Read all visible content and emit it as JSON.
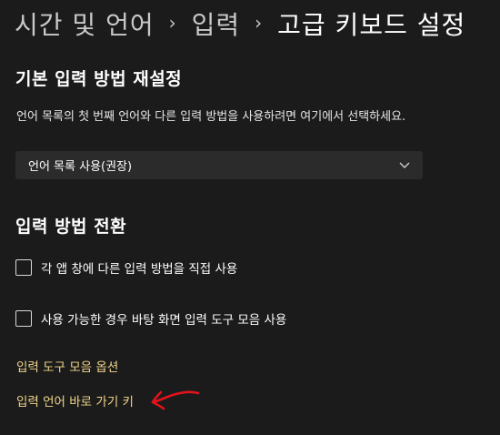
{
  "breadcrumb": {
    "parent1": "시간 및 언어",
    "separator": "›",
    "parent2": "입력",
    "current": "고급 키보드 설정"
  },
  "reset_section": {
    "title": "기본 입력 방법 재설정",
    "description": "언어 목록의 첫 번째 언어와 다른 입력 방법을 사용하려면 여기에서 선택하세요.",
    "dropdown_value": "언어 목록 사용(권장)",
    "dropdown_icon": "chevron-down-icon"
  },
  "switch_section": {
    "title": "입력 방법 전환",
    "checkboxes": [
      {
        "label": "각 앱 창에 다른 입력 방법을 직접 사용",
        "checked": false
      },
      {
        "label": "사용 가능한 경우 바탕 화면 입력 도구 모음 사용",
        "checked": false
      }
    ]
  },
  "links": {
    "toolbar_options": "입력 도구 모음 옵션",
    "hotkeys": "입력 언어 바로 가기 키"
  },
  "annotation": {
    "icon": "red-arrow-annotation",
    "color": "#e3121b"
  },
  "colors": {
    "background": "#1b1b1b",
    "link": "#f0d58a",
    "dropdown_bg": "#2b2b2b"
  }
}
